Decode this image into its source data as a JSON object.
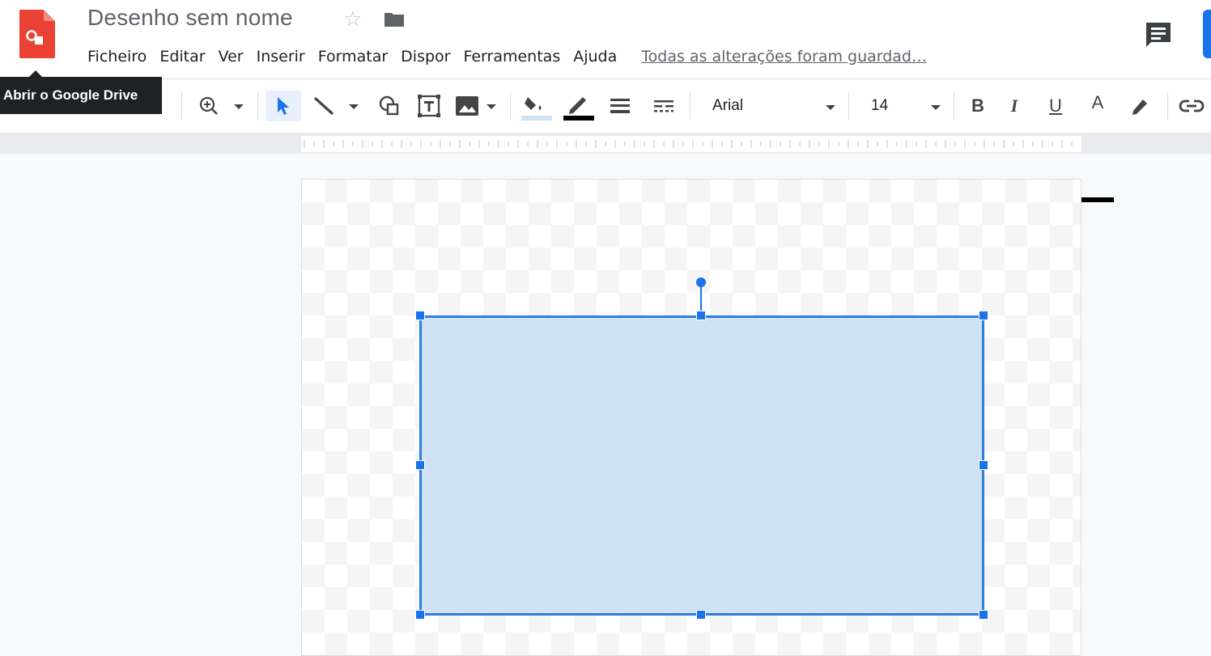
{
  "document": {
    "title": "Desenho sem nome"
  },
  "menubar": {
    "items": [
      "Ficheiro",
      "Editar",
      "Ver",
      "Inserir",
      "Formatar",
      "Dispor",
      "Ferramentas",
      "Ajuda"
    ],
    "save_status": "Todas as alterações foram guardad…"
  },
  "tooltip": {
    "text": "Abrir o Google Drive"
  },
  "toolbar": {
    "font_name": "Arial",
    "font_size": "14",
    "bold_label": "B",
    "italic_label": "I",
    "underline_label": "U",
    "text_color_label": "A"
  },
  "colors": {
    "accent": "#1a73e8",
    "shape_fill": "#cfe2f3",
    "shape_border": "#2f7ee0",
    "logo": "#ea4335"
  },
  "icons": {
    "app": "google-drawings-icon",
    "star": "star-outline-icon",
    "folder": "folder-icon",
    "comments": "comments-icon",
    "zoom": "zoom-in-icon",
    "select": "cursor-arrow-icon",
    "line": "line-icon",
    "shape": "shape-icon",
    "textbox": "text-box-icon",
    "image": "image-icon",
    "fill": "fill-color-icon",
    "border_color": "border-color-icon",
    "border_weight": "border-weight-icon",
    "border_dash": "border-dash-icon",
    "highlight": "highlight-icon",
    "link": "link-icon"
  }
}
